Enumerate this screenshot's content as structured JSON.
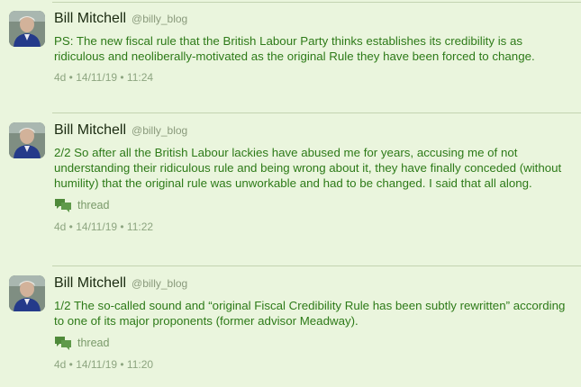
{
  "posts": [
    {
      "author": "Bill Mitchell",
      "handle": "@billy_blog",
      "text": "PS: The new fiscal rule that the British Labour Party thinks establishes its credibility is as ridiculous and neoliberally-motivated as the original Rule they have been forced to change.",
      "meta": "4d • 14/11/19 • 11:24"
    },
    {
      "author": "Bill Mitchell",
      "handle": "@billy_blog",
      "text": "2/2 So after all the British Labour lackies have abused me for years, accusing me of not understanding their ridiculous rule and being wrong about it, they have finally conceded (without humility) that the original rule was unworkable and had to be changed. I said that all along.",
      "thread_label": "thread",
      "meta": "4d • 14/11/19 • 11:22"
    },
    {
      "author": "Bill Mitchell",
      "handle": "@billy_blog",
      "text": "1/2 The so-called sound and “original Fiscal Credibility Rule has been subtly rewritten” according to one of its major proponents (former advisor Meadway).",
      "thread_label": "thread",
      "meta": "4d • 14/11/19 • 11:20"
    }
  ],
  "icons": {
    "avatar": "avatar-photo",
    "thread": "speech-bubbles-icon"
  },
  "colors": {
    "background": "#eaf5dd",
    "post_text": "#2d7a18",
    "name": "#1a2a10",
    "meta": "#8da580"
  }
}
